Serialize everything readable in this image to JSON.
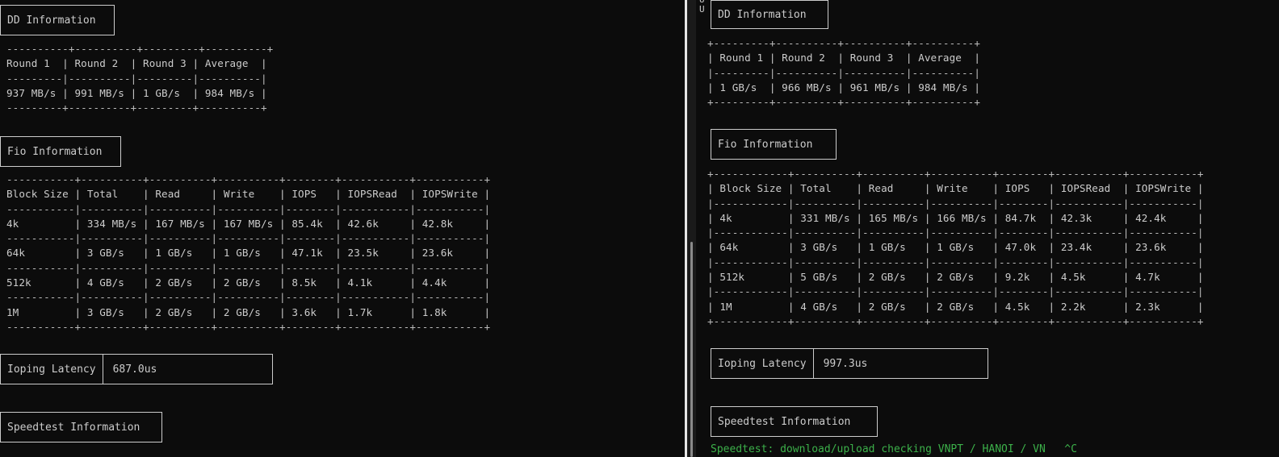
{
  "left": {
    "dd_title": "DD Information",
    "dd_table": [
      "----------+----------+---------+----------+",
      "Round 1  | Round 2  | Round 3 | Average  |",
      "---------|----------|---------|----------|",
      "937 MB/s | 991 MB/s | 1 GB/s  | 984 MB/s |",
      "---------+----------+---------+----------+"
    ],
    "fio_title": "Fio Information",
    "fio_table": [
      "-----------+----------+----------+----------+--------+-----------+-----------+",
      "Block Size | Total    | Read     | Write    | IOPS   | IOPSRead  | IOPSWrite |",
      "-----------|----------|----------|----------|--------|-----------|-----------|",
      "4k         | 334 MB/s | 167 MB/s | 167 MB/s | 85.4k  | 42.6k     | 42.8k     |",
      "-----------|----------|----------|----------|--------|-----------|-----------|",
      "64k        | 3 GB/s   | 1 GB/s   | 1 GB/s   | 47.1k  | 23.5k     | 23.6k     |",
      "-----------|----------|----------|----------|--------|-----------|-----------|",
      "512k       | 4 GB/s   | 2 GB/s   | 2 GB/s   | 8.5k   | 4.1k      | 4.4k      |",
      "-----------|----------|----------|----------|--------|-----------|-----------|",
      "1M         | 3 GB/s   | 2 GB/s   | 2 GB/s   | 3.6k   | 1.7k      | 1.8k      |",
      "-----------+----------+----------+----------+--------+-----------+-----------+"
    ],
    "ioping_label": "Ioping Latency",
    "ioping_value": "687.0us",
    "speedtest_title": "Speedtest Information"
  },
  "right": {
    "corner_text": "U\nU",
    "dd_title": "DD Information",
    "dd_table": [
      "+---------+----------+----------+----------+",
      "| Round 1 | Round 2  | Round 3  | Average  |",
      "|---------|----------|----------|----------|",
      "| 1 GB/s  | 966 MB/s | 961 MB/s | 984 MB/s |",
      "+---------+----------+----------+----------+"
    ],
    "fio_title": "Fio Information",
    "fio_table": [
      "+------------+----------+----------+----------+--------+-----------+-----------+",
      "| Block Size | Total    | Read     | Write    | IOPS   | IOPSRead  | IOPSWrite |",
      "|------------|----------|----------|----------|--------|-----------|-----------|",
      "| 4k         | 331 MB/s | 165 MB/s | 166 MB/s | 84.7k  | 42.3k     | 42.4k     |",
      "|------------|----------|----------|----------|--------|-----------|-----------|",
      "| 64k        | 3 GB/s   | 1 GB/s   | 1 GB/s   | 47.0k  | 23.4k     | 23.6k     |",
      "|------------|----------|----------|----------|--------|-----------|-----------|",
      "| 512k       | 5 GB/s   | 2 GB/s   | 2 GB/s   | 9.2k   | 4.5k      | 4.7k      |",
      "|------------|----------|----------|----------|--------|-----------|-----------|",
      "| 1M         | 4 GB/s   | 2 GB/s   | 2 GB/s   | 4.5k   | 2.2k      | 2.3k      |",
      "+------------+----------+----------+----------+--------+-----------+-----------+"
    ],
    "ioping_label": "Ioping Latency",
    "ioping_value": "997.3us",
    "speedtest_title": "Speedtest Information",
    "status_line": "Speedtest: download/upload checking VNPT / HANOI / VN   ^C"
  },
  "colors": {
    "background": "#0c0c0c",
    "text": "#cccccc",
    "prompt_green": "#3cb14a"
  }
}
